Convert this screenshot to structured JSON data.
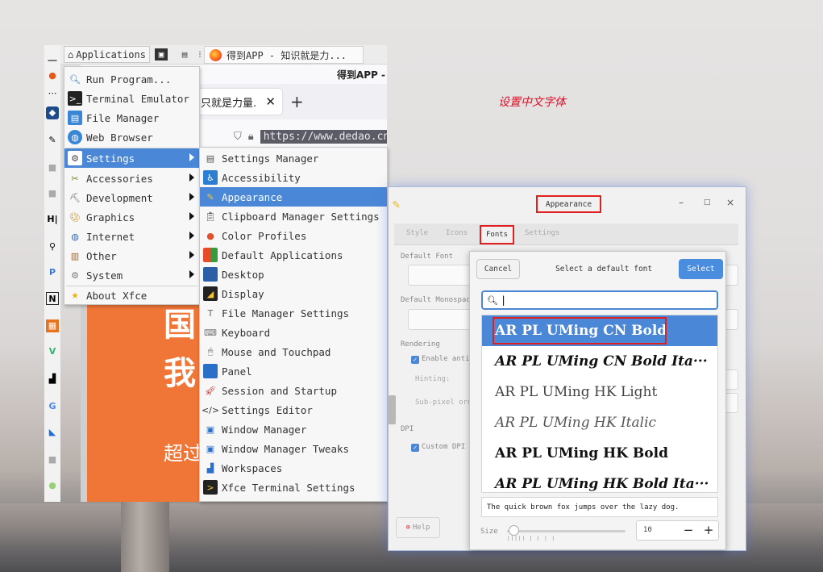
{
  "annotation": "设置中文字体",
  "top_panel": {
    "applications_label": "Applications",
    "task_title": "得到APP - 知识就是力..."
  },
  "browser": {
    "window_title": "得到APP -",
    "tab_title": "只就是力量.",
    "url": "https://www.dedao.cn",
    "content_line1": "国",
    "content_line2": "我",
    "content_line3": "超过"
  },
  "app_menu": {
    "items": [
      {
        "label": "Run Program...",
        "icon": "magnifier-icon"
      },
      {
        "label": "Terminal Emulator",
        "icon": "terminal-icon"
      },
      {
        "label": "File Manager",
        "icon": "file-manager-icon"
      },
      {
        "label": "Web Browser",
        "icon": "web-browser-icon"
      },
      {
        "label": "Settings",
        "icon": "settings-icon",
        "submenu": true,
        "selected": true
      },
      {
        "label": "Accessories",
        "icon": "accessories-icon",
        "submenu": true
      },
      {
        "label": "Development",
        "icon": "development-icon",
        "submenu": true
      },
      {
        "label": "Graphics",
        "icon": "graphics-icon",
        "submenu": true
      },
      {
        "label": "Internet",
        "icon": "internet-icon",
        "submenu": true
      },
      {
        "label": "Other",
        "icon": "other-icon",
        "submenu": true
      },
      {
        "label": "System",
        "icon": "system-icon",
        "submenu": true
      },
      {
        "label": "About Xfce",
        "icon": "star-icon"
      }
    ]
  },
  "settings_menu": {
    "items": [
      {
        "label": "Settings Manager",
        "icon": "settings-manager-icon"
      },
      {
        "label": "Accessibility",
        "icon": "accessibility-icon"
      },
      {
        "label": "Appearance",
        "icon": "appearance-icon",
        "selected": true
      },
      {
        "label": "Clipboard Manager Settings",
        "icon": "clipboard-icon"
      },
      {
        "label": "Color Profiles",
        "icon": "color-profiles-icon"
      },
      {
        "label": "Default Applications",
        "icon": "default-apps-icon"
      },
      {
        "label": "Desktop",
        "icon": "desktop-icon"
      },
      {
        "label": "Display",
        "icon": "display-icon"
      },
      {
        "label": "File Manager Settings",
        "icon": "file-manager-settings-icon"
      },
      {
        "label": "Keyboard",
        "icon": "keyboard-icon"
      },
      {
        "label": "Mouse and Touchpad",
        "icon": "mouse-icon"
      },
      {
        "label": "Panel",
        "icon": "panel-icon"
      },
      {
        "label": "Session and Startup",
        "icon": "rocket-icon"
      },
      {
        "label": "Settings Editor",
        "icon": "code-icon"
      },
      {
        "label": "Window Manager",
        "icon": "window-manager-icon"
      },
      {
        "label": "Window Manager Tweaks",
        "icon": "window-tweaks-icon"
      },
      {
        "label": "Workspaces",
        "icon": "workspaces-icon"
      },
      {
        "label": "Xfce Terminal Settings",
        "icon": "terminal-settings-icon"
      }
    ]
  },
  "appearance": {
    "title": "Appearance",
    "tabs": [
      "Style",
      "Icons",
      "Fonts",
      "Settings"
    ],
    "active_tab": "Fonts",
    "default_font_label": "Default Font",
    "default_mono_label": "Default Monospace",
    "rendering_label": "Rendering",
    "antialias_label": "Enable anti",
    "hinting_label": "Hinting:",
    "subpixel_label": "Sub-pixel ord",
    "dpi_label": "DPI",
    "custom_dpi_label": "Custom DPI s",
    "help_label": "Help"
  },
  "font_dialog": {
    "cancel_label": "Cancel",
    "title": "Select a default font",
    "select_label": "Select",
    "search_value": "",
    "fonts": [
      {
        "name": "AR PL UMing CN Bold",
        "style": "bold",
        "selected": true
      },
      {
        "name": "AR PL UMing CN Bold Ita···",
        "style": "bold-italic"
      },
      {
        "name": "AR PL UMing HK Light",
        "style": "light"
      },
      {
        "name": "AR PL UMing HK Italic",
        "style": "italic"
      },
      {
        "name": "AR PL UMing HK Bold",
        "style": "bold"
      },
      {
        "name": "AR PL UMing HK Bold Ita···",
        "style": "bold-italic"
      }
    ],
    "preview_text": "The quick brown fox jumps over the lazy dog.",
    "size_label": "Size",
    "size_value": "10",
    "minus_label": "−",
    "plus_label": "+"
  },
  "colors": {
    "accent": "#4a87d6",
    "highlight_box": "#e02020",
    "annotation": "#e0102a",
    "browser_banner": "#f07637"
  }
}
